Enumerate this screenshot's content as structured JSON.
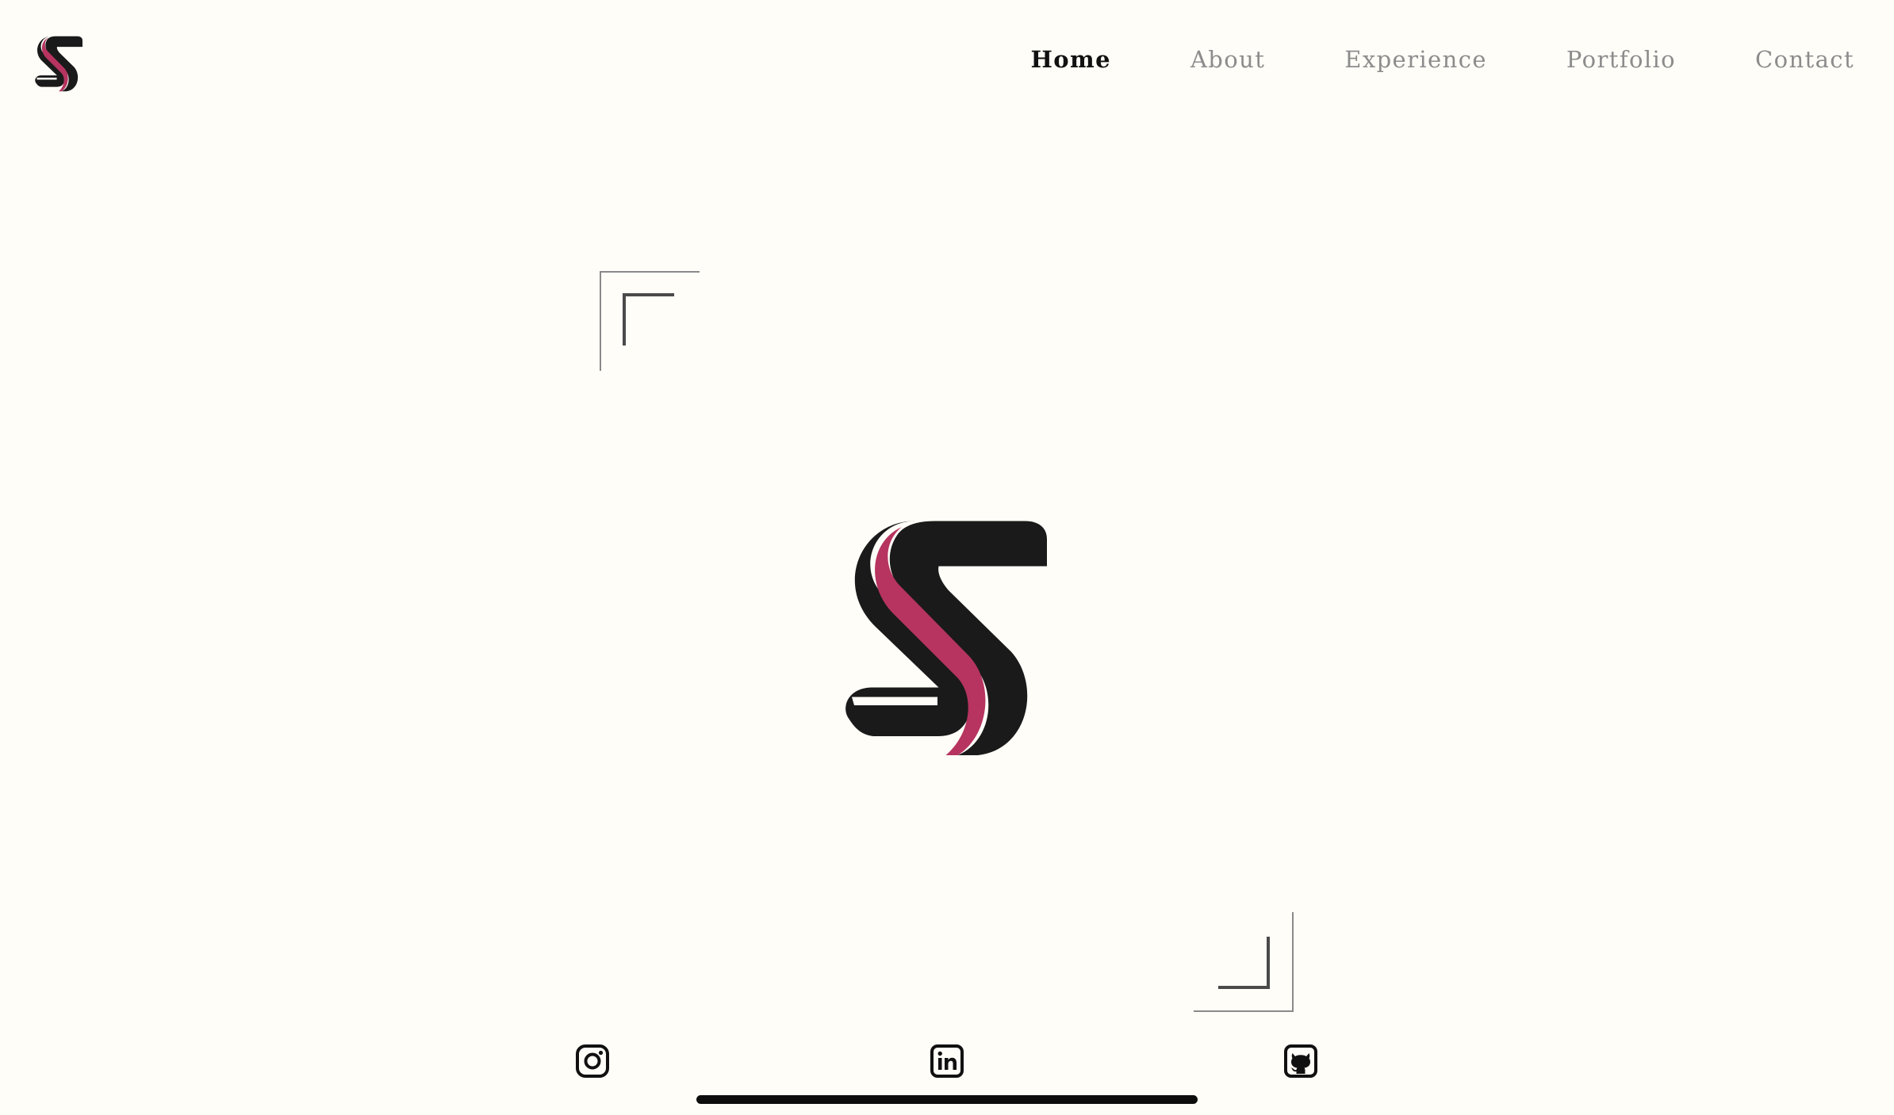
{
  "brand": {
    "logo_icon": "sf-monogram-icon",
    "colors": {
      "dark": "#1a1a1a",
      "accent": "#b6345f",
      "background": "#fefdf8"
    }
  },
  "nav": {
    "items": [
      {
        "label": "Home",
        "active": true
      },
      {
        "label": "About",
        "active": false
      },
      {
        "label": "Experience",
        "active": false
      },
      {
        "label": "Portfolio",
        "active": false
      },
      {
        "label": "Contact",
        "active": false
      }
    ],
    "active_color": "#111111",
    "inactive_color": "#8c8c8c"
  },
  "hero": {
    "logo_icon": "sf-monogram-icon",
    "frame": [
      "corner-top-left",
      "corner-bottom-right"
    ]
  },
  "social": [
    {
      "icon": "instagram-icon"
    },
    {
      "icon": "linkedin-icon"
    },
    {
      "icon": "github-icon"
    }
  ]
}
